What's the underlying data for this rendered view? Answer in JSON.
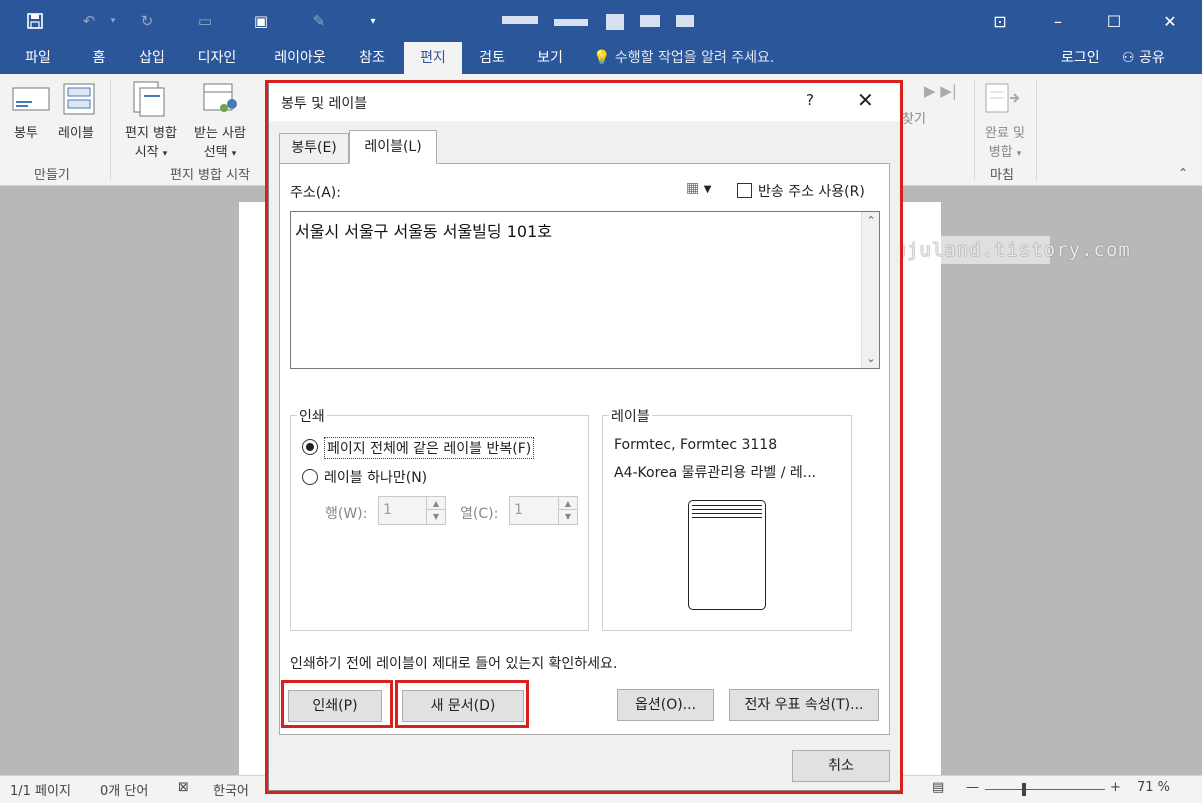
{
  "ribbon_tabs": [
    "파일",
    "홈",
    "삽입",
    "디자인",
    "레이아웃",
    "참조",
    "편지",
    "검토",
    "보기"
  ],
  "tell_me": "수행할 작업을 알려 주세요.",
  "login": "로그인",
  "share": "공유",
  "ribbon": {
    "envelope": "봉투",
    "labels": "레이블",
    "start_merge_1": "편지 병합",
    "start_merge_2": "시작",
    "select_recipients_1": "받는 사람",
    "select_recipients_2": "선택",
    "group_create": "만들기",
    "group_start_merge": "편지 병합 시작",
    "find": "찾기",
    "finish_1": "완료 및",
    "finish_2": "병합",
    "group_finish": "마침"
  },
  "status": {
    "page": "1/1 페이지",
    "words": "0개 단어",
    "lang": "한국어",
    "zoom": "71 %"
  },
  "dialog": {
    "title": "봉투 및 레이블",
    "help": "?",
    "tab_envelopes": "봉투(E)",
    "tab_labels": "레이블(L)",
    "address_label": "주소(A):",
    "return_address": "반송 주소 사용(R)",
    "address_value": "서울시 서울구 서울동 서울빌딩 101호",
    "print_group": "인쇄",
    "full_page": "페이지 전체에 같은 레이블 반복(F)",
    "single_label": "레이블 하나만(N)",
    "row_label": "행(W):",
    "col_label": "열(C):",
    "row_value": "1",
    "col_value": "1",
    "label_group": "레이블",
    "label_vendor": "Formtec, Formtec 3118",
    "label_desc": "A4-Korea 물류관리용 라벨 / 레...",
    "hint": "인쇄하기 전에 레이블이 제대로 들어 있는지 확인하세요.",
    "btn_print": "인쇄(P)",
    "btn_new_doc": "새 문서(D)",
    "btn_options": "옵션(O)...",
    "btn_epostage": "전자 우표 속성(T)...",
    "btn_cancel": "취소"
  },
  "watermark": "http://jujuland.tistory.com",
  "colors": {
    "accent": "#2b579a",
    "highlight": "#d9201c"
  }
}
